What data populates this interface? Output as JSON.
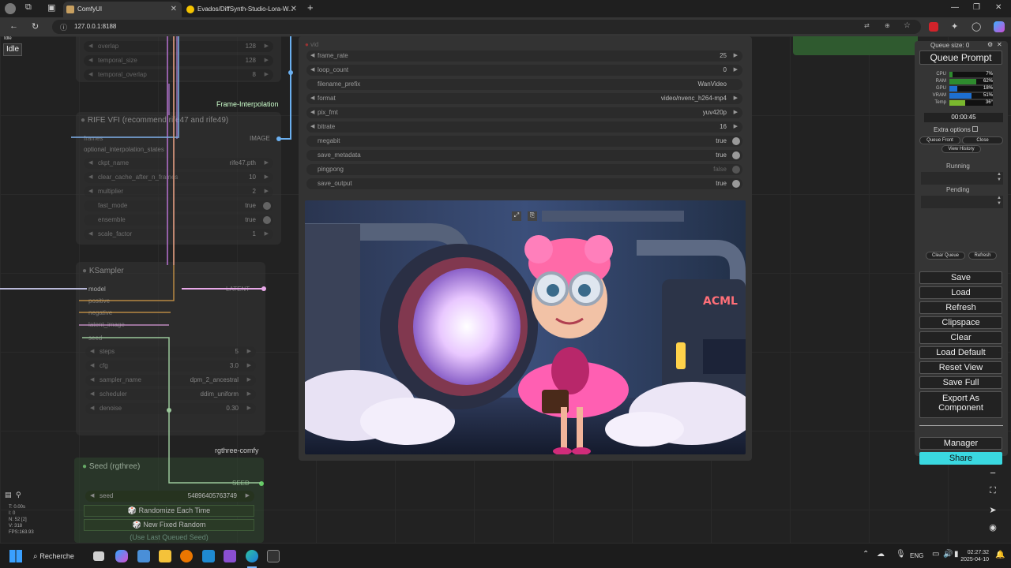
{
  "browser": {
    "tabs": [
      {
        "title": "ComfyUI",
        "active": true
      },
      {
        "title": "Evados/DiffSynth-Studio-Lora-W...",
        "active": false
      }
    ],
    "url": "127.0.0.1:8188"
  },
  "status": {
    "badge_small": "Idle",
    "badge": "Idle"
  },
  "nodes": {
    "top_widgets": [
      {
        "label": "overlap",
        "value": "128"
      },
      {
        "label": "temporal_size",
        "value": "128"
      },
      {
        "label": "temporal_overlap",
        "value": "8"
      }
    ],
    "frame_interpolation_group": "Frame-Interpolation",
    "rife": {
      "title": "RIFE VFI (recommend rife47 and rife49)",
      "inputs": [
        "frames",
        "optional_interpolation_states"
      ],
      "output": "IMAGE",
      "widgets": [
        {
          "label": "ckpt_name",
          "value": "rife47.pth"
        },
        {
          "label": "clear_cache_after_n_frames",
          "value": "10"
        },
        {
          "label": "multiplier",
          "value": "2"
        },
        {
          "label": "fast_mode",
          "value": "true"
        },
        {
          "label": "ensemble",
          "value": "true"
        },
        {
          "label": "scale_factor",
          "value": "1"
        }
      ]
    },
    "ksampler": {
      "title": "KSampler",
      "inputs": [
        "model",
        "positive",
        "negative",
        "latent_image",
        "seed"
      ],
      "output": "LATENT",
      "widgets": [
        {
          "label": "steps",
          "value": "5"
        },
        {
          "label": "cfg",
          "value": "3.0"
        },
        {
          "label": "sampler_name",
          "value": "dpm_2_ancestral"
        },
        {
          "label": "scheduler",
          "value": "ddim_uniform"
        },
        {
          "label": "denoise",
          "value": "0.30"
        }
      ]
    },
    "rgthree_group": "rgthree-comfy",
    "seed": {
      "title": "Seed (rgthree)",
      "output": "SEED",
      "seed_label": "seed",
      "seed_value": "54896405763749",
      "buttons": [
        "Randomize Each Time",
        "New Fixed Random",
        "(Use Last Queued Seed)"
      ]
    },
    "video": {
      "header": "vid",
      "widgets": [
        {
          "label": "frame_rate",
          "value": "25",
          "kind": "num"
        },
        {
          "label": "loop_count",
          "value": "0",
          "kind": "num"
        },
        {
          "label": "filename_prefix",
          "value": "WanVideo",
          "kind": "text"
        },
        {
          "label": "format",
          "value": "video/nvenc_h264-mp4",
          "kind": "num"
        },
        {
          "label": "pix_fmt",
          "value": "yuv420p",
          "kind": "num"
        },
        {
          "label": "bitrate",
          "value": "16",
          "kind": "num"
        },
        {
          "label": "megabit",
          "value": "true",
          "kind": "toggle"
        },
        {
          "label": "save_metadata",
          "value": "true",
          "kind": "toggle"
        },
        {
          "label": "pingpong",
          "value": "false",
          "kind": "toggle-off"
        },
        {
          "label": "save_output",
          "value": "true",
          "kind": "toggle"
        }
      ],
      "sign_text": "ACML"
    }
  },
  "stats": {
    "lines": [
      "T: 0.00s",
      "I: 0",
      "N: 52 [2]",
      "V: 318",
      "FPS:163.93"
    ]
  },
  "menu": {
    "queue_size": "Queue size: 0",
    "queue_prompt": "Queue Prompt",
    "monitors": [
      {
        "name": "CPU",
        "value": "7%",
        "fill": 0.07,
        "color": "#2e8b2e"
      },
      {
        "name": "RAM",
        "value": "62%",
        "fill": 0.62,
        "color": "#2e8b2e"
      },
      {
        "name": "GPU",
        "value": "18%",
        "fill": 0.18,
        "color": "#1e6fd0"
      },
      {
        "name": "VRAM",
        "value": "51%",
        "fill": 0.51,
        "color": "#1e6fd0"
      },
      {
        "name": "Temp",
        "value": "36°",
        "fill": 0.36,
        "color": "#7ab82e"
      }
    ],
    "timer": "00:00:45",
    "extra_options": "Extra options",
    "queue_front": "Queue Front",
    "close": "Close",
    "view_history": "View History",
    "running": "Running",
    "pending": "Pending",
    "clear_queue": "Clear Queue",
    "refresh_small": "Refresh",
    "buttons": [
      "Save",
      "Load",
      "Refresh",
      "Clipspace",
      "Clear",
      "Load Default",
      "Reset View",
      "Save Full"
    ],
    "export": "Export As Component",
    "manager": "Manager",
    "share": "Share"
  },
  "taskbar": {
    "search": "Recherche",
    "lang": "ENG",
    "time": "02:27:32",
    "date": "2025-04-10"
  }
}
